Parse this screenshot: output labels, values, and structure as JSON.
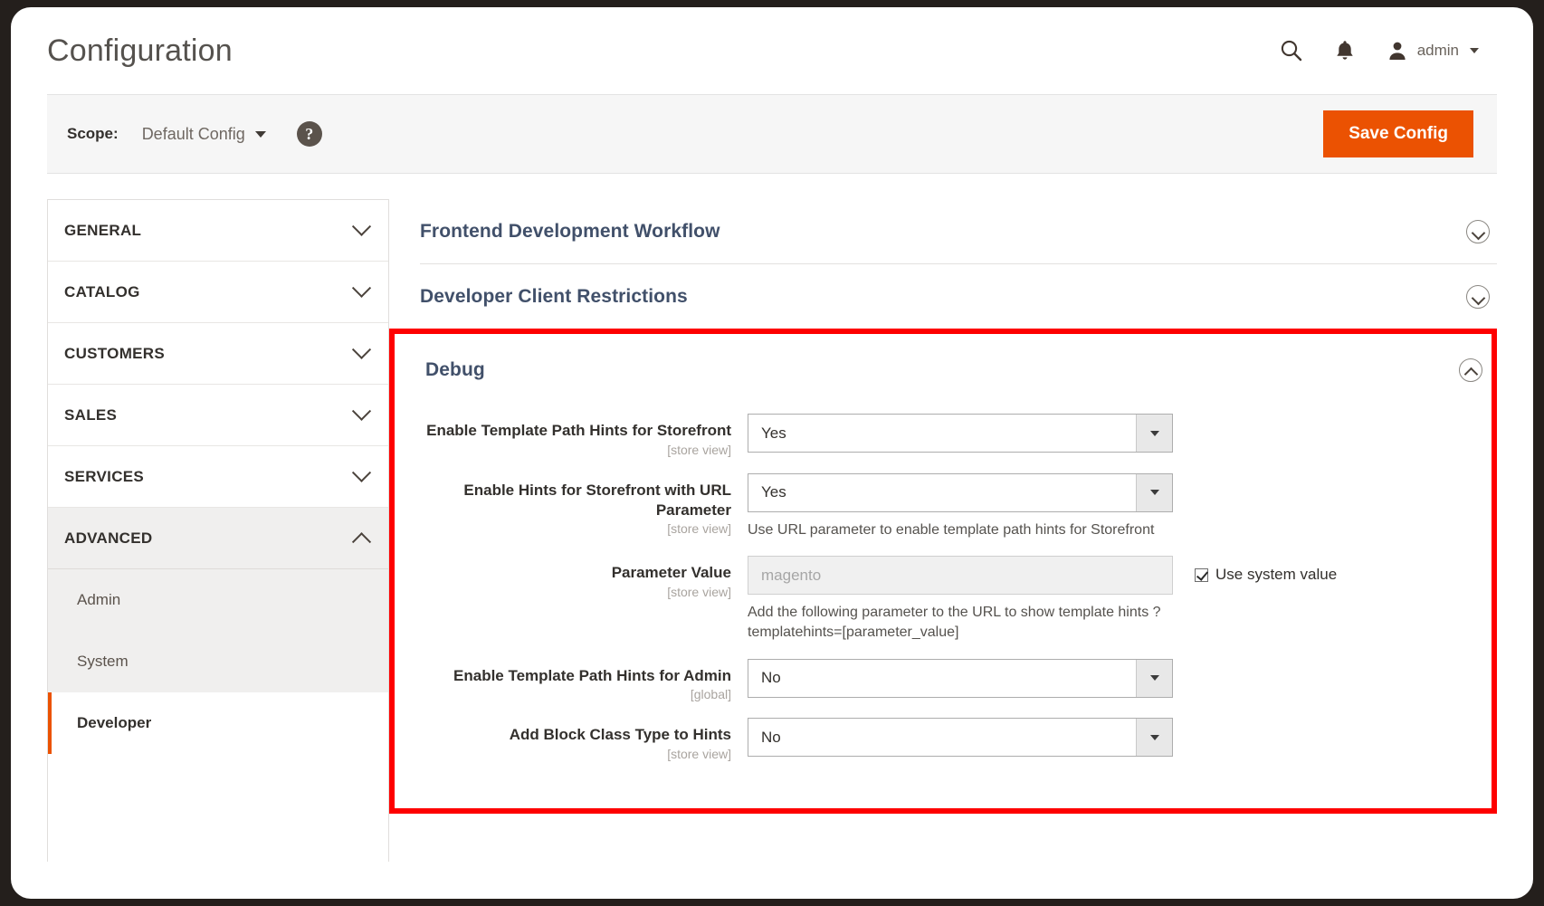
{
  "header": {
    "title": "Configuration",
    "search_icon": "search-icon",
    "notification_icon": "bell-icon",
    "user_icon": "user-avatar-icon",
    "user_name": "admin",
    "user_caret": "chevron-down-icon"
  },
  "scope_bar": {
    "label": "Scope:",
    "value": "Default Config",
    "help_icon": "question-mark-icon",
    "save_label": "Save Config",
    "accent_color": "#eb5202"
  },
  "sidebar": {
    "groups": [
      {
        "label": "GENERAL",
        "expanded": false
      },
      {
        "label": "CATALOG",
        "expanded": false
      },
      {
        "label": "CUSTOMERS",
        "expanded": false
      },
      {
        "label": "SALES",
        "expanded": false
      },
      {
        "label": "SERVICES",
        "expanded": false
      },
      {
        "label": "ADVANCED",
        "expanded": true
      }
    ],
    "advanced_items": [
      {
        "label": "Admin",
        "selected": false
      },
      {
        "label": "System",
        "selected": false
      },
      {
        "label": "Developer",
        "selected": true
      }
    ]
  },
  "main": {
    "sections": [
      {
        "title": "Frontend Development Workflow",
        "expanded": false
      },
      {
        "title": "Developer Client Restrictions",
        "expanded": false
      },
      {
        "title": "Debug",
        "expanded": true,
        "highlighted": true
      }
    ],
    "highlight_color": "#fe0000",
    "debug_fields": [
      {
        "label": "Enable Template Path Hints for Storefront",
        "scope": "[store view]",
        "control": "select",
        "value": "Yes",
        "note": "",
        "use_system_value": false
      },
      {
        "label": "Enable Hints for Storefront with URL Parameter",
        "scope": "[store view]",
        "control": "select",
        "value": "Yes",
        "note": "Use URL parameter to enable template path hints for Storefront",
        "use_system_value": false
      },
      {
        "label": "Parameter Value",
        "scope": "[store view]",
        "control": "text",
        "value": "",
        "placeholder": "magento",
        "note": "Add the following parameter to the URL to show template hints ? templatehints=[parameter_value]",
        "use_system_value": true,
        "use_system_value_label": "Use system value"
      },
      {
        "label": "Enable Template Path Hints for Admin",
        "scope": "[global]",
        "control": "select",
        "value": "No",
        "note": "",
        "use_system_value": false
      },
      {
        "label": "Add Block Class Type to Hints",
        "scope": "[store view]",
        "control": "select",
        "value": "No",
        "note": "",
        "use_system_value": false
      }
    ]
  }
}
